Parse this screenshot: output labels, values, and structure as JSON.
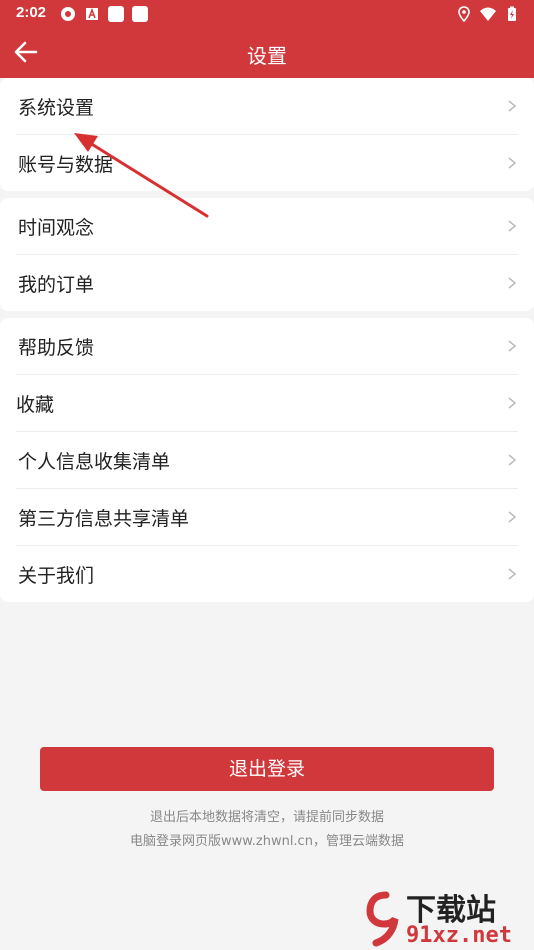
{
  "status_bar": {
    "time": "2:02"
  },
  "header": {
    "title": "设置",
    "back_icon": "arrow-left-icon"
  },
  "groups": [
    {
      "items": [
        {
          "label": "系统设置"
        },
        {
          "label": "账号与数据"
        }
      ]
    },
    {
      "items": [
        {
          "label": "时间观念"
        },
        {
          "label": "我的订单"
        }
      ]
    },
    {
      "items": [
        {
          "label": "帮助反馈"
        },
        {
          "label": "收藏"
        },
        {
          "label": "个人信息收集清单"
        },
        {
          "label": "第三方信息共享清单"
        },
        {
          "label": "关于我们"
        }
      ]
    }
  ],
  "logout": {
    "label": "退出登录",
    "hint_line1": "退出后本地数据将清空，请提前同步数据",
    "hint_line2": "电脑登录网页版www.zhwnl.cn，管理云端数据"
  },
  "watermark": {
    "text1": "下载站",
    "text2": "91xz.net"
  },
  "colors": {
    "brand_red": "#d0383c",
    "background": "#f4f4f4"
  }
}
